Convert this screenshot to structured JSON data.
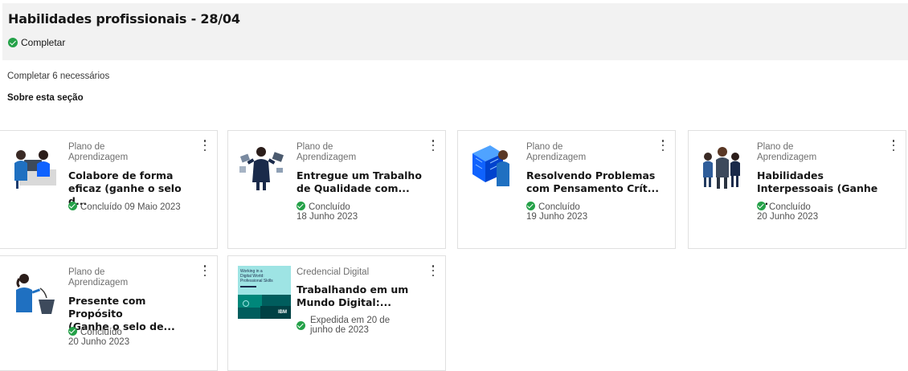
{
  "header": {
    "title": "Habilidades profissionais - 28/04",
    "status": "Completar"
  },
  "summary": {
    "required": "Completar 6 necessários",
    "about": "Sobre esta seção"
  },
  "cards": [
    {
      "type_line1": "Plano de",
      "type_line2": "Aprendizagem",
      "title_line1": "Colabore de forma",
      "title_line2": "eficaz (ganhe o selo d...",
      "status_line1": "Concluído 09 Maio 2023",
      "status_line2": ""
    },
    {
      "type_line1": "Plano de",
      "type_line2": "Aprendizagem",
      "title_line1": "Entregue um Trabalho",
      "title_line2": "de Qualidade com...",
      "status_line1": "Concluído",
      "status_line2": "18 Junho 2023"
    },
    {
      "type_line1": "Plano de",
      "type_line2": "Aprendizagem",
      "title_line1": "Resolvendo Problemas",
      "title_line2": "com Pensamento Crít...",
      "status_line1": "Concluído",
      "status_line2": "19 Junho 2023"
    },
    {
      "type_line1": "Plano de",
      "type_line2": "Aprendizagem",
      "title_line1": "Habilidades",
      "title_line2": "Interpessoais (Ganhe ...",
      "status_line1": "Concluído",
      "status_line2": "20 Junho 2023"
    },
    {
      "type_line1": "Plano de",
      "type_line2": "Aprendizagem",
      "title_line1": "Presente com Propósito",
      "title_line2": "(Ganhe o selo de...",
      "status_line1": "Concluído",
      "status_line2": "20 Junho 2023"
    },
    {
      "type_line1": "Credencial Digital",
      "type_line2": "",
      "title_line1": "Trabalhando em um",
      "title_line2": "Mundo Digital:...",
      "status_line1": "Expedida em 20 de",
      "status_line2": "junho de 2023",
      "badge_text": [
        "Working in a",
        "Digital World:",
        "Professional Skills"
      ],
      "badge_brand": "IBM"
    }
  ],
  "colors": {
    "success": "#24a148",
    "header_bg": "#f2f2f2",
    "card_border": "#e0e0e0"
  },
  "icons": {
    "status": "checkmark-filled-icon",
    "menu": "overflow-menu-vertical-icon"
  }
}
